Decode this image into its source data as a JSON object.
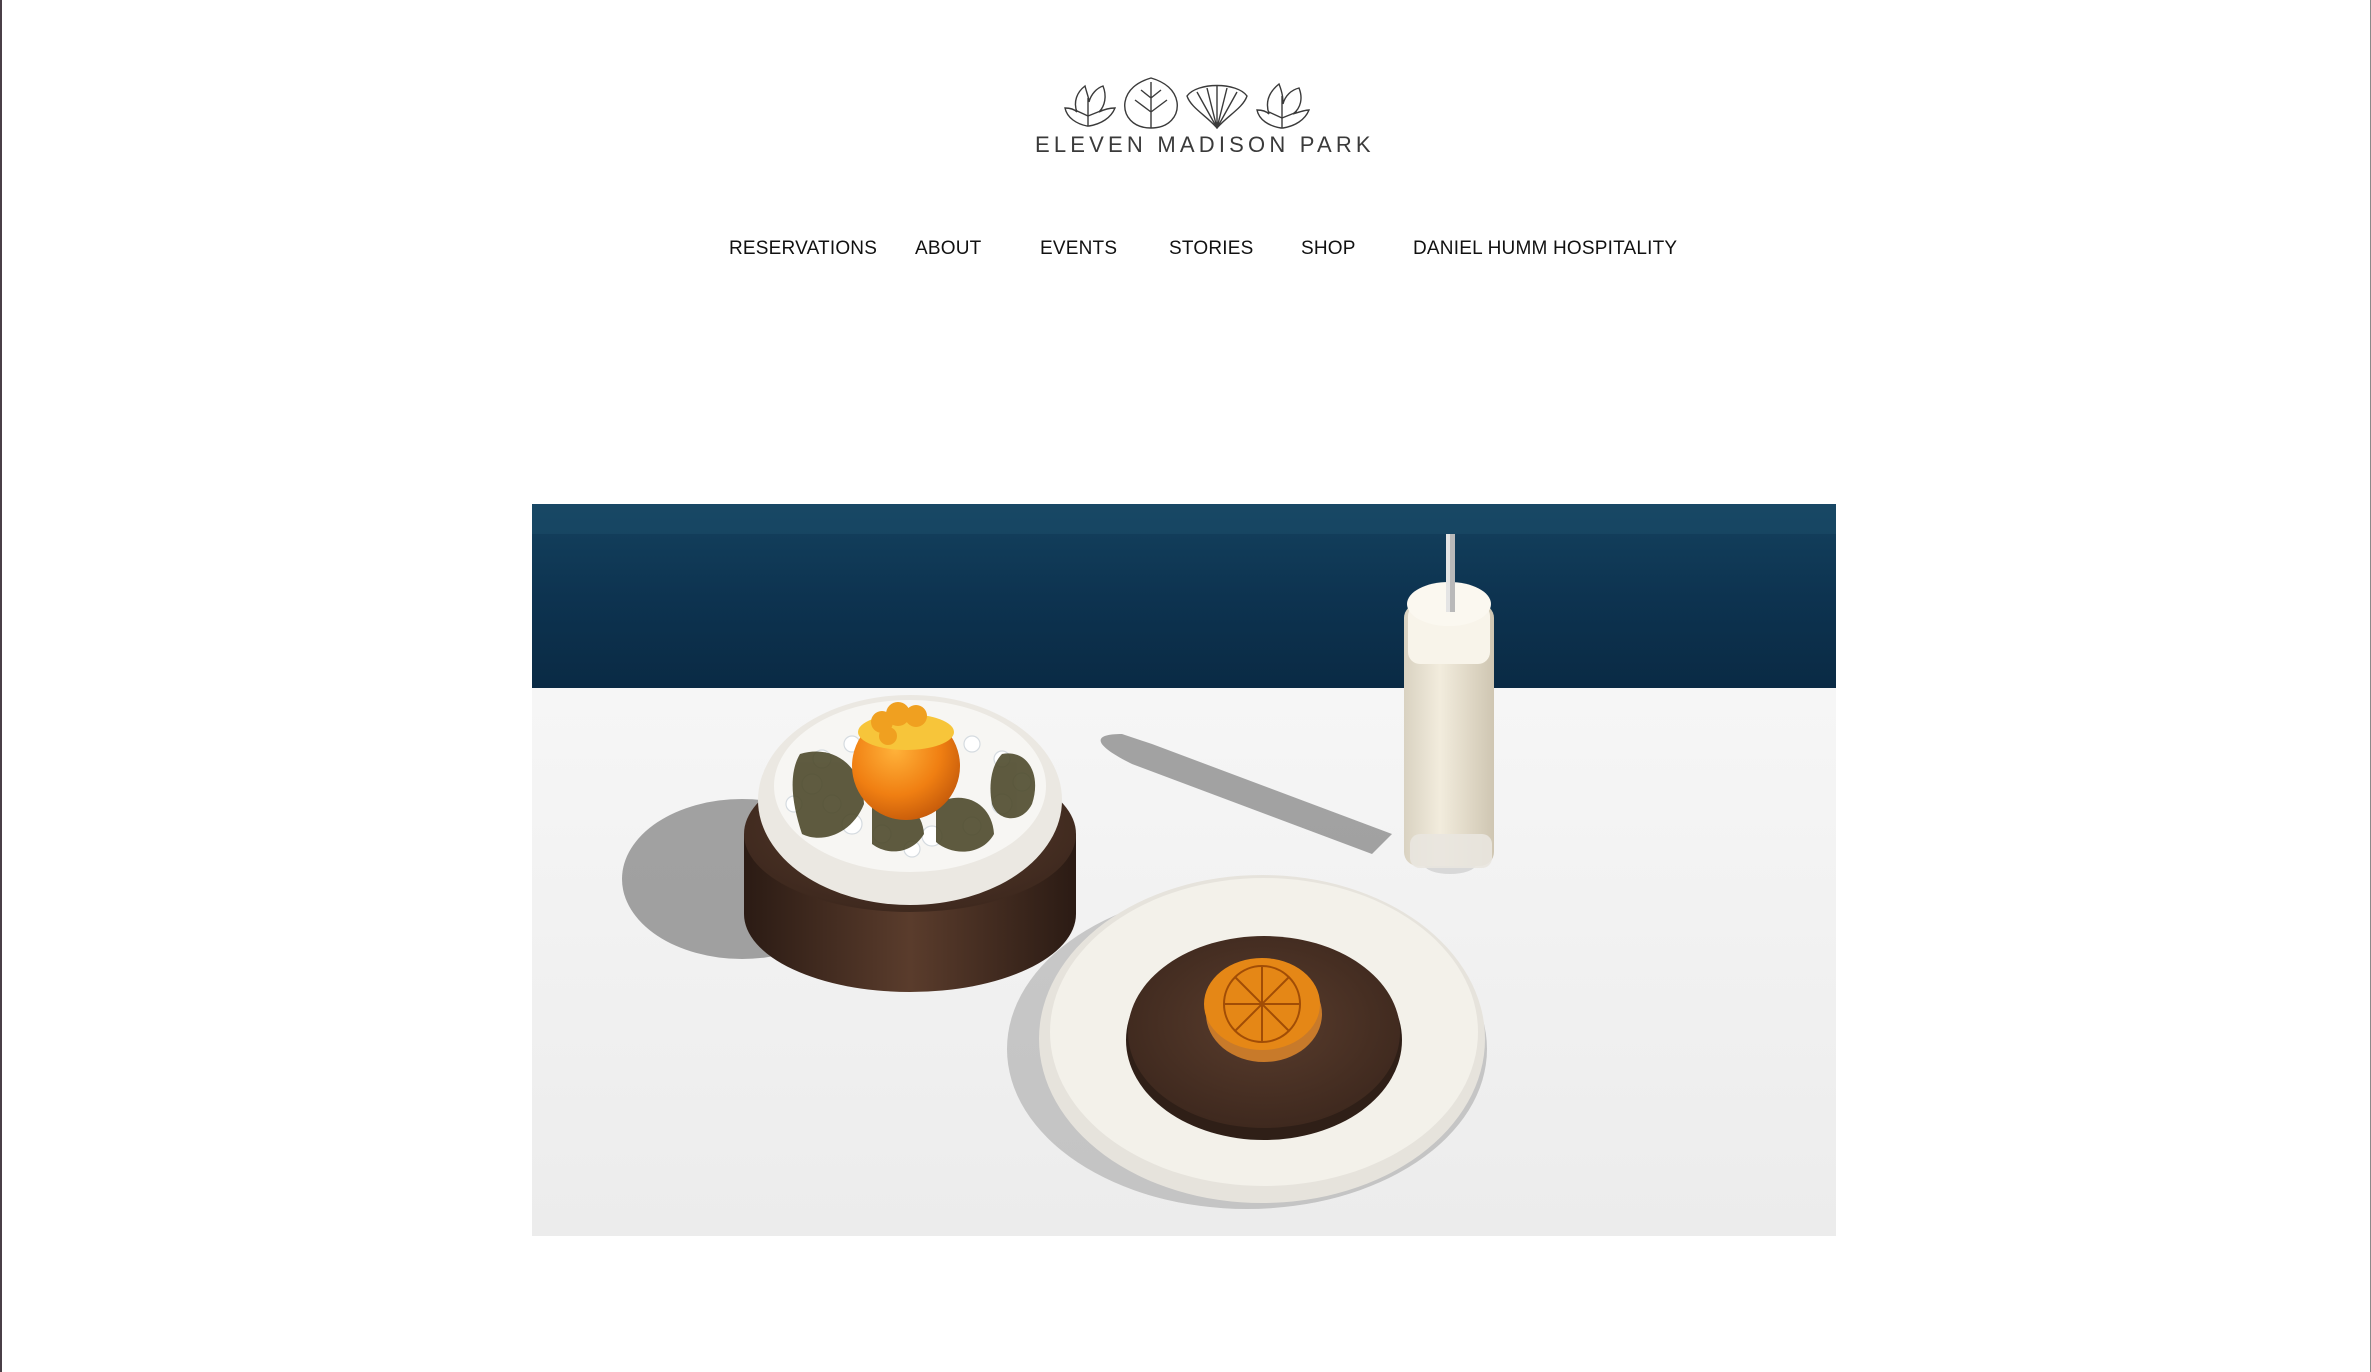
{
  "brand": {
    "name": "ELEVEN MADISON PARK",
    "logo_icon": "four-leaf-mark-icon"
  },
  "nav": {
    "items": [
      {
        "label": "RESERVATIONS"
      },
      {
        "label": "ABOUT"
      },
      {
        "label": "EVENTS"
      },
      {
        "label": "STORIES"
      },
      {
        "label": "SHOP"
      },
      {
        "label": "DANIEL HUMM HOSPITALITY"
      }
    ]
  },
  "hero": {
    "image": "hero-food-photo",
    "subjects": [
      "bowl-with-citrus-on-ice",
      "glass-with-straw",
      "plate-with-dried-orange-slice"
    ]
  },
  "colors": {
    "background": "#ffffff",
    "text": "#111111",
    "banquette": "#0f3a55",
    "table": "#f1f1f1",
    "wood": "#4a3226",
    "citrus": "#e8821a"
  }
}
